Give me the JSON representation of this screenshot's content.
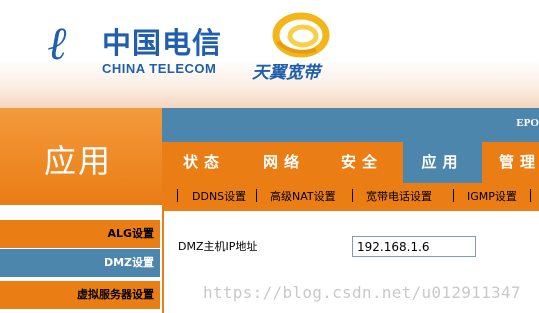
{
  "header": {
    "brand_cn": "中国电信",
    "brand_en": "CHINA TELECOM",
    "subbrand": "天翼宽带",
    "brand_color": "#1f5fae"
  },
  "section": {
    "title": "应用"
  },
  "top_strip": {
    "text": "EPO"
  },
  "tabs": [
    {
      "label": "状态",
      "active": false
    },
    {
      "label": "网络",
      "active": false
    },
    {
      "label": "安全",
      "active": false
    },
    {
      "label": "应用",
      "active": true
    },
    {
      "label": "管理",
      "active": false
    }
  ],
  "subtabs": [
    "DDNS设置",
    "高级NAT设置",
    "宽带电话设置",
    "IGMP设置"
  ],
  "menu": [
    {
      "label": "ALG设置",
      "active": false
    },
    {
      "label": "DMZ设置",
      "active": true
    },
    {
      "label": "虚拟服务器设置",
      "active": false
    }
  ],
  "form": {
    "dmz_ip_label": "DMZ主机IP地址",
    "dmz_ip_value": "192.168.1.6"
  },
  "watermark": "https://blog.csdn.net/u012911347",
  "colors": {
    "orange": "#ea7d14",
    "blue": "#4d86ad",
    "gold": "#f2b619"
  }
}
